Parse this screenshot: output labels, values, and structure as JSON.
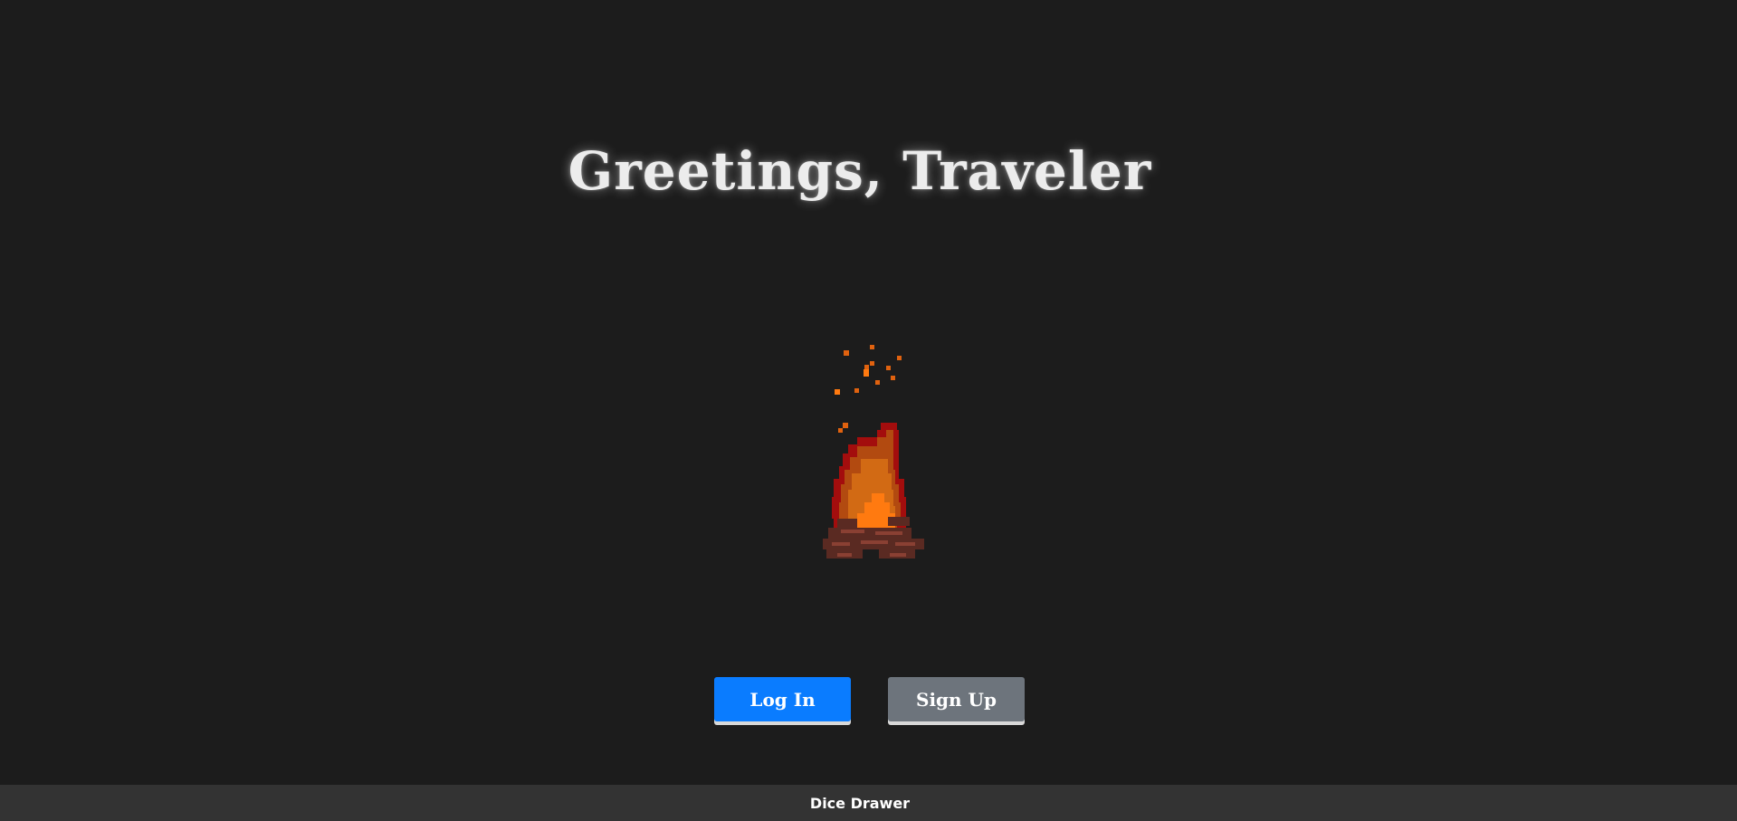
{
  "heading": {
    "title": "Greetings, Traveler"
  },
  "illustration": {
    "icon": "campfire-icon",
    "colors": {
      "flame_outer": "#a30d0d",
      "flame_mid": "#c25a10",
      "flame_inner": "#ff7a10",
      "logs": "#5a2a22"
    }
  },
  "actions": {
    "login_label": "Log In",
    "signup_label": "Sign Up"
  },
  "footer": {
    "brand": "Dice Drawer"
  },
  "colors": {
    "background": "#1c1c1c",
    "footer_background": "#333333",
    "login_button": "#0a7cff",
    "signup_button": "#6d747c"
  }
}
